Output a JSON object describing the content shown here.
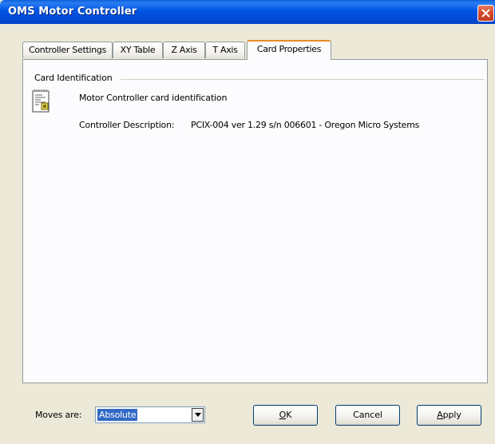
{
  "window": {
    "title": "OMS Motor Controller"
  },
  "tabs": [
    {
      "label": "Controller Settings"
    },
    {
      "label": "XY Table"
    },
    {
      "label": "Z Axis"
    },
    {
      "label": "T Axis"
    },
    {
      "label": "Card Properties",
      "active": true
    }
  ],
  "card": {
    "group_label": "Card Identification",
    "title": "Motor Controller card identification",
    "description_label": "Controller Description:",
    "description_value": "PCIX-004 ver 1.29 s/n 006601 - Oregon Micro Systems"
  },
  "moves": {
    "label": "Moves are:",
    "selected": "Absolute"
  },
  "buttons": {
    "ok": {
      "accel": "O",
      "rest": "K"
    },
    "cancel": "Cancel",
    "apply": {
      "accel": "A",
      "rest": "pply"
    }
  },
  "colors": {
    "titlebar": "#0055e5",
    "window_bg": "#ece9d8",
    "panel_bg": "#fcfcfe",
    "active_tab_accent": "#e68b2c",
    "selection": "#316ac5"
  }
}
